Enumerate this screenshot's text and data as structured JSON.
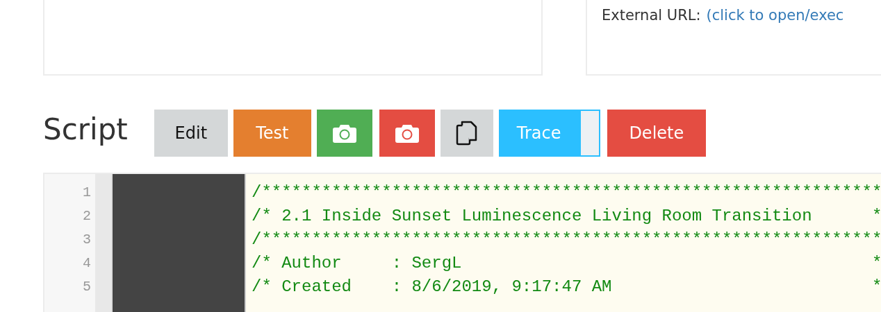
{
  "external_url": {
    "label": "External URL:",
    "link": "(click to open/exec"
  },
  "script": {
    "heading": "Script",
    "buttons": [
      {
        "kind": "text",
        "label": "Edit",
        "color": "#d4d7d8"
      },
      {
        "kind": "text",
        "label": "Test",
        "color": "#e47f2f"
      },
      {
        "kind": "camera",
        "color": "#50ae54"
      },
      {
        "kind": "camera",
        "color": "#e44d42"
      },
      {
        "kind": "copy",
        "color": "#d4d7d8"
      },
      {
        "kind": "split",
        "label": "Trace",
        "color": "#2bbfff"
      },
      {
        "kind": "text",
        "label": "Delete",
        "color": "#e44d42"
      }
    ]
  },
  "editor": {
    "lines": [
      {
        "number": "1",
        "code": "/**************************************************************"
      },
      {
        "number": "2",
        "code": "/* 2.1 Inside Sunset Luminescence Living Room Transition      *"
      },
      {
        "number": "3",
        "code": "/**************************************************************"
      },
      {
        "number": "4",
        "code": "/* Author     : SergL                                         *"
      },
      {
        "number": "5",
        "code": "/* Created    : 8/6/2019, 9:17:47 AM                          *"
      }
    ]
  }
}
